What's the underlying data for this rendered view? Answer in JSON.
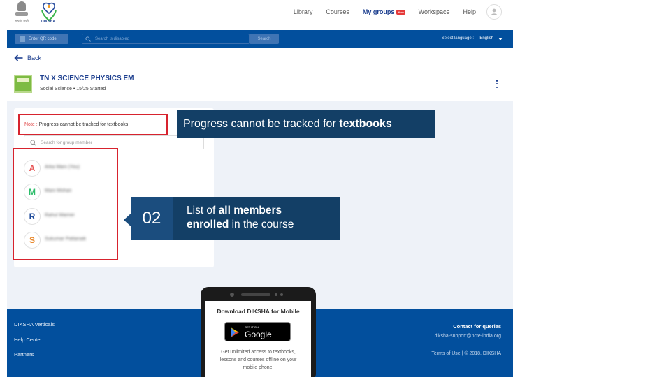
{
  "header": {
    "emblem_text": "सत्यमेव जयते",
    "logo_text": "DIKSHA",
    "nav": {
      "library": "Library",
      "courses": "Courses",
      "my_groups": "My groups",
      "new_badge": "New",
      "workspace": "Workspace",
      "help": "Help"
    }
  },
  "searchbar": {
    "qr_label": "Enter QR code",
    "search_placeholder": "Search is disabled",
    "search_button": "Search",
    "language_label": "Select language :",
    "language_value": "English"
  },
  "back": {
    "label": "Back"
  },
  "course": {
    "title": "TN X SCIENCE PHYSICS EM",
    "subtitle": "Social Science • 15/25 Started"
  },
  "members": {
    "note_key": "Note :",
    "note_text": "Progress cannot be tracked for textbooks",
    "search_placeholder": "Search for group member",
    "list": [
      {
        "initial": "A",
        "name": "Arka Mani (You)",
        "color": "#e75555"
      },
      {
        "initial": "M",
        "name": "Mani Mohan",
        "color": "#2ebd6b"
      },
      {
        "initial": "R",
        "name": "Rahul Warrier",
        "color": "#1d4a9a"
      },
      {
        "initial": "S",
        "name": "Sukumar Pattanaik",
        "color": "#e8872a"
      }
    ]
  },
  "callouts": {
    "one": {
      "text_prefix": "Progress cannot be tracked for ",
      "text_bold": "textbooks"
    },
    "two": {
      "number": "02",
      "prefix": "List of ",
      "bold_1": "all members",
      "bold_2": "enrolled",
      "suffix": " in the course"
    }
  },
  "footer": {
    "links": [
      "DIKSHA Verticals",
      "Help Center",
      "Partners"
    ],
    "contact_title": "Contact for queries",
    "contact_email": "diksha-support@ncte-india.org",
    "terms": "Terms of Use | © 2018, DIKSHA"
  },
  "promo": {
    "title": "Download DIKSHA for Mobile",
    "badge_small": "GET IT ON",
    "badge_big": "Google Play",
    "description": "Get unlimited access to textbooks, lessons and courses offline on your mobile phone."
  },
  "colors": {
    "brand_blue": "#024f9d",
    "callout_navy": "#133f66",
    "highlight_red": "#d7232e",
    "body_bg": "#eef2f8"
  }
}
